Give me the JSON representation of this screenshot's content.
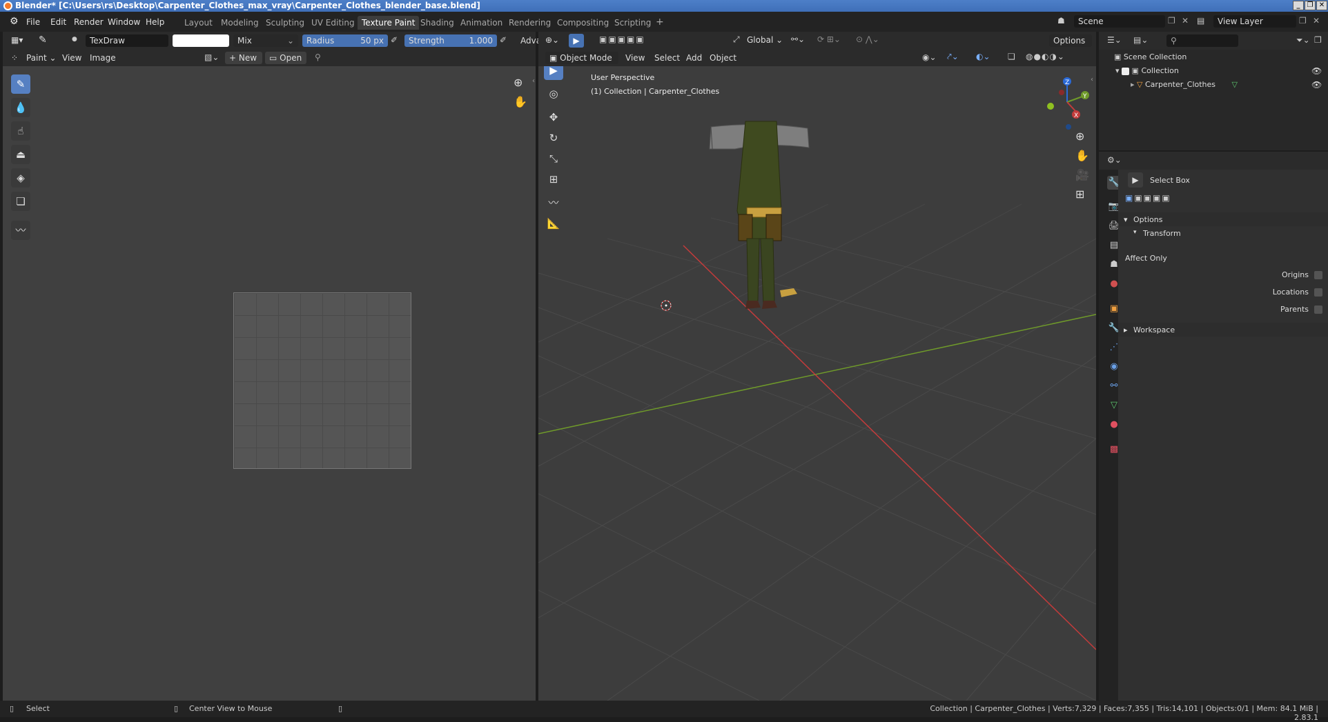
{
  "title": "Blender* [C:\\Users\\rs\\Desktop\\Carpenter_Clothes_max_vray\\Carpenter_Clothes_blender_base.blend]",
  "menus": [
    "File",
    "Edit",
    "Render",
    "Window",
    "Help"
  ],
  "workspaces": [
    "Layout",
    "Modeling",
    "Sculpting",
    "UV Editing",
    "Texture Paint",
    "Shading",
    "Animation",
    "Rendering",
    "Compositing",
    "Scripting"
  ],
  "active_workspace": "Texture Paint",
  "scene": "Scene",
  "view_layer": "View Layer",
  "image_editor": {
    "brush_name": "TexDraw",
    "blend_mode": "Mix",
    "radius_label": "Radius",
    "radius_value": "50 px",
    "strength_label": "Strength",
    "strength_value": "1.000",
    "adv_label": "Adva",
    "mode": "Paint",
    "view_menu": "View",
    "image_menu": "Image",
    "new_label": "New",
    "open_label": "Open"
  },
  "viewport": {
    "orientation": "Global",
    "options_label": "Options",
    "mode": "Object Mode",
    "menus": [
      "View",
      "Select",
      "Add",
      "Object"
    ],
    "perspective_label": "User Perspective",
    "collection_label": "(1) Collection | Carpenter_Clothes",
    "gizmo": {
      "x": "X",
      "y": "Y",
      "z": "Z"
    }
  },
  "outliner": {
    "scene_collection": "Scene Collection",
    "collection": "Collection",
    "object": "Carpenter_Clothes"
  },
  "properties": {
    "tool_name": "Select Box",
    "options_label": "Options",
    "transform_label": "Transform",
    "affect_only": "Affect Only",
    "origins": "Origins",
    "locations": "Locations",
    "parents": "Parents",
    "workspace_label": "Workspace"
  },
  "statusbar": {
    "select": "Select",
    "center_view": "Center View to Mouse",
    "stats": "Collection | Carpenter_Clothes | Verts:7,329 | Faces:7,355 | Tris:14,101 | Objects:0/1 | Mem: 84.1 MiB | 2.83.1"
  },
  "colors": {
    "accent": "#5680c2",
    "x_axis": "#c43b3b",
    "y_axis": "#6f9a2a",
    "clothes": "#3f4a1f"
  }
}
